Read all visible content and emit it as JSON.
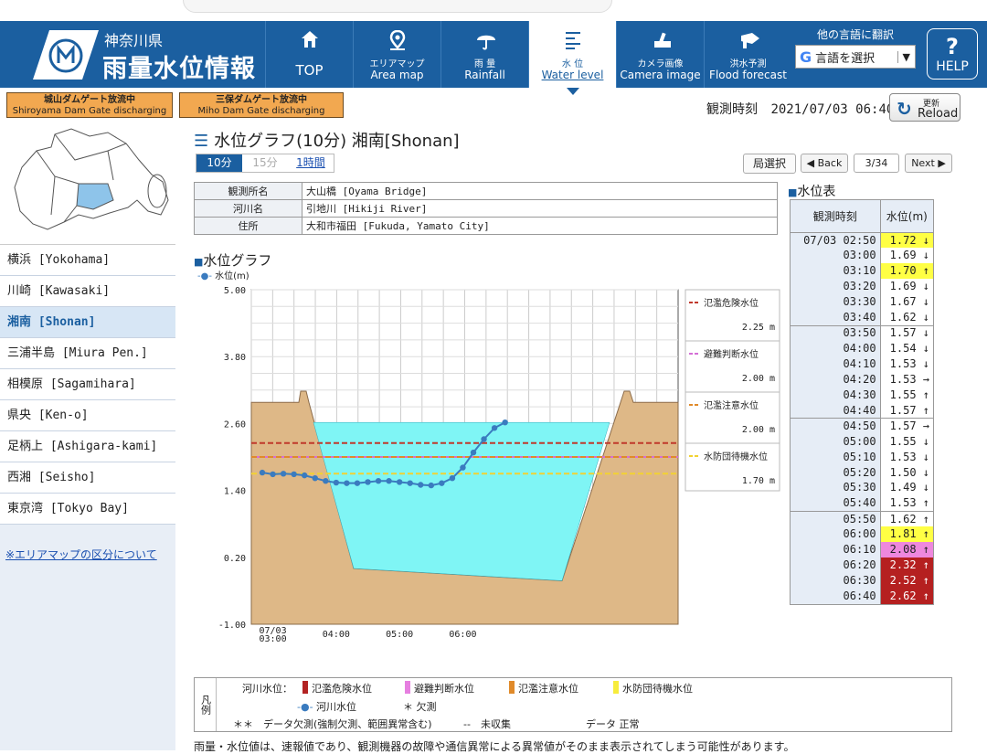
{
  "header": {
    "prefecture": "神奈川県",
    "title": "雨量水位情報",
    "nav": [
      {
        "icon": "home-icon",
        "label_jp": "TOP",
        "label_en": ""
      },
      {
        "icon": "map-pin-icon",
        "label_jp": "エリアマップ",
        "label_en": "Area map"
      },
      {
        "icon": "umbrella-icon",
        "label_jp": "雨 量",
        "label_en": "Rainfall"
      },
      {
        "icon": "water-level-icon",
        "label_jp": "水 位",
        "label_en": "Water level",
        "active": true
      },
      {
        "icon": "camera-icon",
        "label_jp": "カメラ画像",
        "label_en": "Camera image"
      },
      {
        "icon": "megaphone-icon",
        "label_jp": "洪水予測",
        "label_en": "Flood forecast"
      }
    ],
    "translate_label": "他の言語に翻訳",
    "translate_select": "言語を選択",
    "help": "HELP",
    "help_symbol": "?"
  },
  "badges": [
    {
      "jp": "城山ダムゲート放流中",
      "en": "Shiroyama Dam Gate discharging"
    },
    {
      "jp": "三保ダムゲート放流中",
      "en": "Miho Dam Gate discharging"
    }
  ],
  "observation": {
    "label": "観測時刻",
    "value": "2021/07/03 06:40"
  },
  "reload": {
    "jp": "更新",
    "en": "Reload"
  },
  "sidebar": {
    "items": [
      "横浜 [Yokohama]",
      "川崎 [Kawasaki]",
      "湘南 [Shonan]",
      "三浦半島 [Miura Pen.]",
      "相模原 [Sagamihara]",
      "県央 [Ken-o]",
      "足柄上 [Ashigara-kami]",
      "西湘 [Seisho]",
      "東京湾 [Tokyo Bay]"
    ],
    "active_index": 2,
    "link": "※エリアマップの区分について"
  },
  "main": {
    "title": "水位グラフ(10分) 湘南[Shonan]",
    "tabs": [
      "10分",
      "15分",
      "1時間"
    ],
    "select_btn": "局選択",
    "back": "◀ Back",
    "page": "3/34",
    "next": "Next ▶",
    "info": [
      {
        "label": "観測所名",
        "value": "大山橋 [Oyama Bridge]"
      },
      {
        "label": "河川名",
        "value": "引地川 [Hikiji River]"
      },
      {
        "label": "住所",
        "value": "大和市福田 [Fukuda, Yamato City]"
      }
    ],
    "graph_title": "水位グラフ",
    "graph_series_label": "水位(m)"
  },
  "chart_data": {
    "type": "line",
    "ylabel": "水位(m)",
    "yticks": [
      "5.00",
      "3.80",
      "2.60",
      "1.40",
      "0.20",
      "-1.00"
    ],
    "ylim": [
      -1.0,
      5.0
    ],
    "xticks": [
      "07/03\n03:00",
      "04:00",
      "05:00",
      "06:00"
    ],
    "x": [
      "02:50",
      "03:00",
      "03:10",
      "03:20",
      "03:30",
      "03:40",
      "03:50",
      "04:00",
      "04:10",
      "04:20",
      "04:30",
      "04:40",
      "04:50",
      "05:00",
      "05:10",
      "05:20",
      "05:30",
      "05:40",
      "05:50",
      "06:00",
      "06:10",
      "06:20",
      "06:30",
      "06:40"
    ],
    "series": [
      {
        "name": "河川水位",
        "color": "#3a7bbf",
        "values": [
          1.72,
          1.69,
          1.7,
          1.69,
          1.67,
          1.62,
          1.57,
          1.54,
          1.53,
          1.53,
          1.55,
          1.57,
          1.57,
          1.55,
          1.53,
          1.5,
          1.49,
          1.53,
          1.62,
          1.81,
          2.08,
          2.32,
          2.52,
          2.62
        ]
      }
    ],
    "thresholds": [
      {
        "name": "氾濫危険水位",
        "value": 2.25,
        "label": "2.25 m",
        "color": "#c0392b"
      },
      {
        "name": "避難判断水位",
        "value": 2.0,
        "label": "2.00 m",
        "color": "#d46fd6"
      },
      {
        "name": "氾濫注意水位",
        "value": 2.0,
        "label": "2.00 m",
        "color": "#e08a2a"
      },
      {
        "name": "水防団待機水位",
        "value": 1.7,
        "label": "1.70 m",
        "color": "#f2d232"
      }
    ],
    "grid": true
  },
  "legend": {
    "side": "凡例",
    "river_label": "河川水位：",
    "items": [
      {
        "label": "氾濫危険水位",
        "color": "#b32323"
      },
      {
        "label": "避難判断水位",
        "color": "#e67fe0"
      },
      {
        "label": "氾濫注意水位",
        "color": "#e08a2a"
      },
      {
        "label": "水防団待機水位",
        "color": "#f7ec3c"
      }
    ],
    "series": "河川水位",
    "missing": "＊ 欠測",
    "note1": "＊＊　データ欠測(強制欠測、範囲異常含む)",
    "note2": "--　未収集",
    "note3": "データ 正常"
  },
  "footnote": "雨量・水位値は、速報値であり、観測機器の故障や通信異常による異常値がそのまま表示されてしまう可能性があります。",
  "wl_table": {
    "title": "水位表",
    "col_time": "観測時刻",
    "col_level": "水位(m)",
    "rows": [
      {
        "t": "07/03 02:50",
        "v": "1.72 ↓",
        "c": "#ffff44"
      },
      {
        "t": "03:00",
        "v": "1.69 ↓",
        "c": ""
      },
      {
        "t": "03:10",
        "v": "1.70 ↑",
        "c": "#ffff44"
      },
      {
        "t": "03:20",
        "v": "1.69 ↓",
        "c": ""
      },
      {
        "t": "03:30",
        "v": "1.67 ↓",
        "c": ""
      },
      {
        "t": "03:40",
        "v": "1.62 ↓",
        "c": ""
      },
      {
        "t": "03:50",
        "v": "1.57 ↓",
        "c": ""
      },
      {
        "t": "04:00",
        "v": "1.54 ↓",
        "c": ""
      },
      {
        "t": "04:10",
        "v": "1.53 ↓",
        "c": ""
      },
      {
        "t": "04:20",
        "v": "1.53 →",
        "c": ""
      },
      {
        "t": "04:30",
        "v": "1.55 ↑",
        "c": ""
      },
      {
        "t": "04:40",
        "v": "1.57 ↑",
        "c": ""
      },
      {
        "t": "04:50",
        "v": "1.57 →",
        "c": ""
      },
      {
        "t": "05:00",
        "v": "1.55 ↓",
        "c": ""
      },
      {
        "t": "05:10",
        "v": "1.53 ↓",
        "c": ""
      },
      {
        "t": "05:20",
        "v": "1.50 ↓",
        "c": ""
      },
      {
        "t": "05:30",
        "v": "1.49 ↓",
        "c": ""
      },
      {
        "t": "05:40",
        "v": "1.53 ↑",
        "c": ""
      },
      {
        "t": "05:50",
        "v": "1.62 ↑",
        "c": ""
      },
      {
        "t": "06:00",
        "v": "1.81 ↑",
        "c": "#ffff44"
      },
      {
        "t": "06:10",
        "v": "2.08 ↑",
        "c": "#ee88dd"
      },
      {
        "t": "06:20",
        "v": "2.32 ↑",
        "c": "#b52020"
      },
      {
        "t": "06:30",
        "v": "2.52 ↑",
        "c": "#b52020"
      },
      {
        "t": "06:40",
        "v": "2.62 ↑",
        "c": "#b52020"
      }
    ]
  }
}
